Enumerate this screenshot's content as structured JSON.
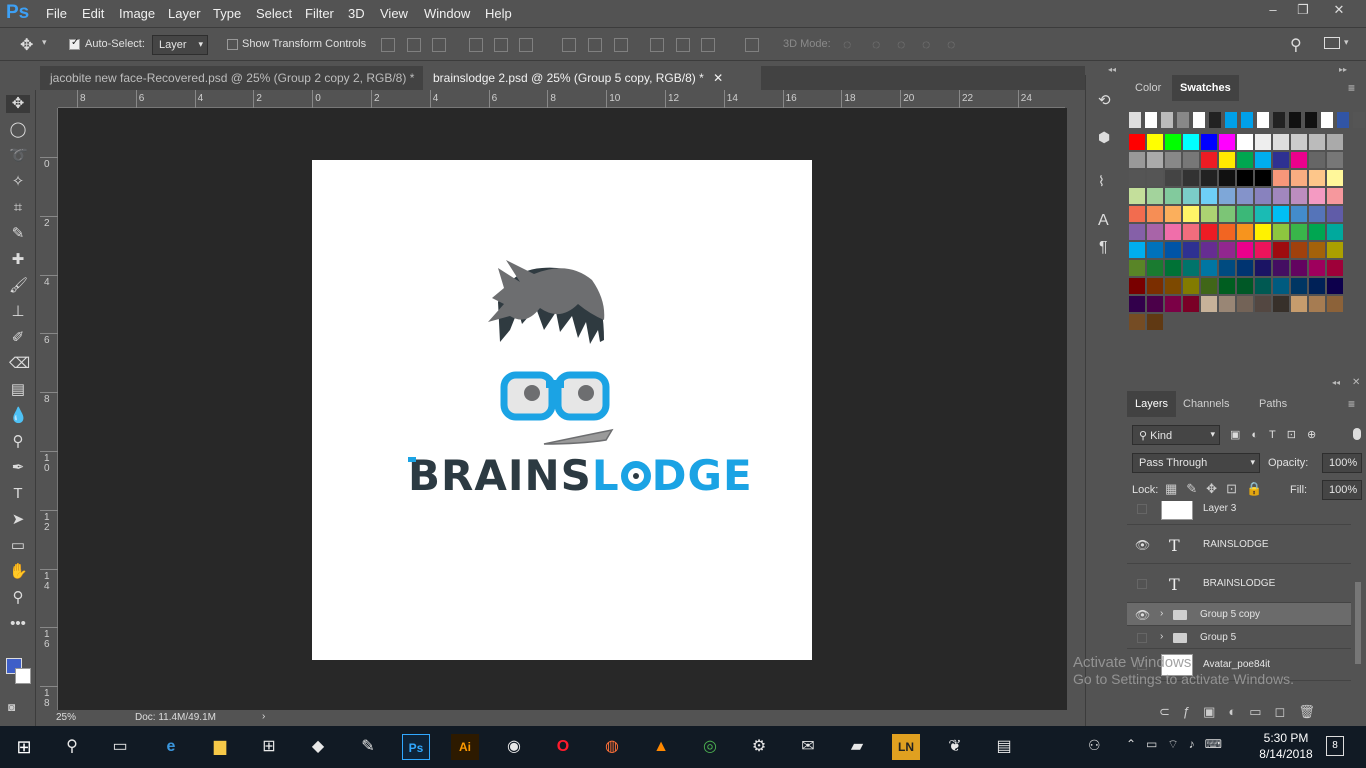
{
  "app": {
    "logo": "Ps"
  },
  "menu": [
    "File",
    "Edit",
    "Image",
    "Layer",
    "Type",
    "Select",
    "Filter",
    "3D",
    "View",
    "Window",
    "Help"
  ],
  "window_controls": {
    "minimize": "‒",
    "restore": "❐",
    "close": "✕"
  },
  "options": {
    "auto_select_label": "Auto-Select:",
    "auto_select_value": "Layer",
    "show_transform_label": "Show Transform Controls",
    "mode_3d_label": "3D Mode:"
  },
  "tabs": [
    {
      "label": "jacobite new face-Recovered.psd @ 25% (Group 2 copy 2, RGB/8) *"
    },
    {
      "label": "brainslodge 2.psd @ 25% (Group 5 copy, RGB/8) *"
    }
  ],
  "ruler_top": [
    "8",
    "6",
    "4",
    "2",
    "0",
    "2",
    "4",
    "6",
    "8",
    "10",
    "12",
    "14",
    "16",
    "18",
    "20",
    "22",
    "24"
  ],
  "ruler_left": [
    "0",
    "2",
    "4",
    "6",
    "8",
    "1\n0",
    "1\n2",
    "1\n4",
    "1\n6",
    "1\n8"
  ],
  "logo": {
    "part1": "BRAINS",
    "part2": "L",
    "part3": "DGE"
  },
  "status": {
    "zoom": "25%",
    "doc": "Doc: 11.4M/49.1M"
  },
  "color_panel": {
    "tab_color": "Color",
    "tab_swatches": "Swatches"
  },
  "swatch_rows": [
    [
      "#dddddd",
      "#ffffff",
      "#bbbbbb",
      "#888888",
      "#ffffff",
      "#222222",
      "#00a0e9",
      "#00a0e9",
      "#ffffff",
      "#222222",
      "#111111",
      "#111111",
      "#ffffff",
      "#3155a6",
      "#555555",
      "#3340a0"
    ],
    [
      "#ff0000",
      "#ffff00",
      "#00ff00",
      "#00ffff",
      "#0000ff",
      "#ff00ff",
      "#ffffff",
      "#eeeeee",
      "#dddddd",
      "#cccccc",
      "#bbbbbb",
      "#aaaaaa"
    ],
    [
      "#999999",
      "#aaaaaa",
      "#888888",
      "#777777",
      "#ed1c24",
      "#ffea00",
      "#00a650",
      "#00aeef",
      "#2e3192",
      "#ec008c",
      "#666666",
      "#777777"
    ],
    [
      "#555555",
      "#555555",
      "#444444",
      "#333333",
      "#222222",
      "#111111",
      "#000000",
      "#000000",
      "#f7977a",
      "#f9ad81",
      "#fdc68a",
      "#fff79a"
    ],
    [
      "#c4df9b",
      "#a3d39c",
      "#82ca9d",
      "#7bcdc8",
      "#6ecff6",
      "#7ea7d8",
      "#8493ca",
      "#8882be",
      "#a187be",
      "#bc8dbf",
      "#f49ac2",
      "#f6989d"
    ],
    [
      "#f26c4f",
      "#f68e55",
      "#fbaf5c",
      "#fff467",
      "#acd372",
      "#7cc576",
      "#3bb878",
      "#1abbb4",
      "#00bff3",
      "#438ccb",
      "#5574b9",
      "#605ca8"
    ],
    [
      "#8560a8",
      "#a864a8",
      "#f06eaa",
      "#f26d7d",
      "#ed1c24",
      "#f26522",
      "#f7941d",
      "#fff200",
      "#8dc63f",
      "#39b54a",
      "#00a651",
      "#00a99d"
    ],
    [
      "#00aeef",
      "#0072bc",
      "#0054a6",
      "#2e3192",
      "#662d91",
      "#92278f",
      "#ec008c",
      "#ed145b",
      "#9e0b0f",
      "#a0410d",
      "#a3620a",
      "#aba000"
    ],
    [
      "#598527",
      "#1a7b30",
      "#007236",
      "#00746b",
      "#0076a3",
      "#004b80",
      "#003471",
      "#1b1464",
      "#440e62",
      "#630460",
      "#9e005d",
      "#9e0039"
    ],
    [
      "#790000",
      "#7b2e00",
      "#7d4900",
      "#827b00",
      "#406618",
      "#005e20",
      "#005826",
      "#005952",
      "#005b7f",
      "#003663",
      "#002157",
      "#0d004c"
    ],
    [
      "#32004b",
      "#4b0049",
      "#7b0046",
      "#7a0026",
      "#c7b299",
      "#998675",
      "#736357",
      "#534741",
      "#37302a",
      "#c69c6d",
      "#a67c52",
      "#8c6239"
    ],
    [
      "#754c24",
      "#603913"
    ]
  ],
  "layers_panel": {
    "tab_layers": "Layers",
    "tab_channels": "Channels",
    "tab_paths": "Paths",
    "filter_kind": "Kind",
    "blend_mode": "Pass Through",
    "opacity_label": "Opacity:",
    "opacity_value": "100%",
    "lock_label": "Lock:",
    "fill_label": "Fill:",
    "fill_value": "100%",
    "layers": [
      {
        "name": "Layer 3",
        "type": "image",
        "visible": false
      },
      {
        "name": "RAINSLODGE",
        "type": "text",
        "visible": true
      },
      {
        "name": "BRAINSLODGE",
        "type": "text",
        "visible": false
      },
      {
        "name": "Group 5 copy",
        "type": "group",
        "visible": true,
        "selected": true
      },
      {
        "name": "Group 5",
        "type": "group",
        "visible": false
      },
      {
        "name": "Avatar_poe84it",
        "type": "image",
        "visible": false
      }
    ]
  },
  "watermark": {
    "line1": "Activate Windows",
    "line2": "Go to Settings to activate Windows."
  },
  "taskbar": {
    "time": "5:30 PM",
    "date": "8/14/2018",
    "notification_count": "8"
  },
  "taskbar_apps": [
    {
      "icon": "search-icon",
      "glyph": "⚲"
    },
    {
      "icon": "task-view-icon",
      "glyph": "▭"
    },
    {
      "icon": "edge-icon",
      "glyph": "e"
    },
    {
      "icon": "file-explorer-icon",
      "glyph": "▆"
    },
    {
      "icon": "store-icon",
      "glyph": "⊞"
    },
    {
      "icon": "app-icon",
      "glyph": "◆"
    },
    {
      "icon": "paint-icon",
      "glyph": "✎"
    },
    {
      "icon": "photoshop-icon",
      "glyph": "Ps"
    },
    {
      "icon": "illustrator-icon",
      "glyph": "Ai"
    },
    {
      "icon": "eclipse-icon",
      "glyph": "◉"
    },
    {
      "icon": "opera-icon",
      "glyph": "O"
    },
    {
      "icon": "firefox-icon",
      "glyph": "◍"
    },
    {
      "icon": "vlc-icon",
      "glyph": "▲"
    },
    {
      "icon": "chrome-icon",
      "glyph": "◎"
    },
    {
      "icon": "settings-icon",
      "glyph": "⚙"
    },
    {
      "icon": "mail-icon",
      "glyph": "✉"
    },
    {
      "icon": "sticky-notes-icon",
      "glyph": "▰"
    },
    {
      "icon": "ln-icon",
      "glyph": "LN"
    },
    {
      "icon": "app2-icon",
      "glyph": "❦"
    },
    {
      "icon": "app3-icon",
      "glyph": "▤"
    }
  ]
}
